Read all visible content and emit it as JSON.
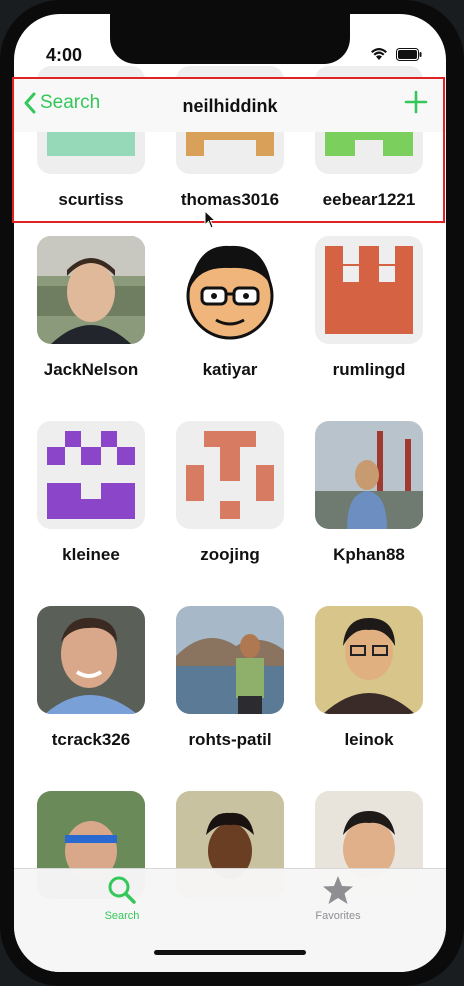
{
  "status_bar": {
    "time": "4:00"
  },
  "nav": {
    "back_label": "Search",
    "title": "neilhiddink",
    "add_icon": "plus-icon"
  },
  "colors": {
    "accent": "#34c759",
    "highlight_box": "#e02222"
  },
  "users": [
    {
      "name": "scurtiss"
    },
    {
      "name": "thomas3016"
    },
    {
      "name": "eebear1221"
    },
    {
      "name": "JackNelson"
    },
    {
      "name": "katiyar"
    },
    {
      "name": "rumlingd"
    },
    {
      "name": "kleinee"
    },
    {
      "name": "zoojing"
    },
    {
      "name": "Kphan88"
    },
    {
      "name": "tcrack326"
    },
    {
      "name": "rohts-patil"
    },
    {
      "name": "leinok"
    },
    {
      "name": ""
    },
    {
      "name": ""
    },
    {
      "name": ""
    }
  ],
  "tabs": [
    {
      "label": "Search",
      "icon": "magnifier-icon",
      "active": true
    },
    {
      "label": "Favorites",
      "icon": "star-icon",
      "active": false
    }
  ]
}
